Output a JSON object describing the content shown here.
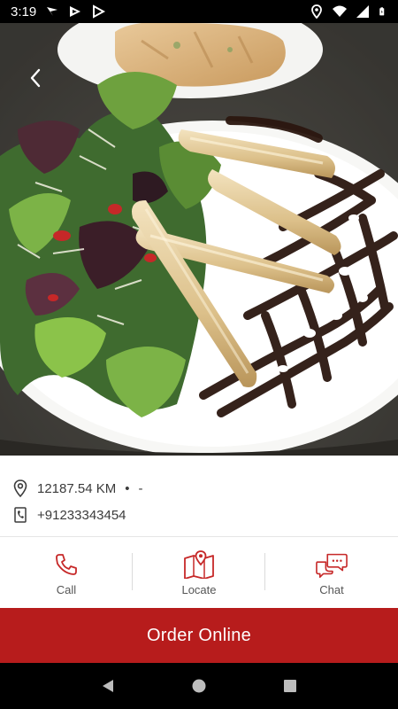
{
  "status_bar": {
    "time": "3:19"
  },
  "header": {
    "back_icon": "chevron-left-icon"
  },
  "info": {
    "distance": "12187.54 KM",
    "separator": "•",
    "extra": "-",
    "phone": "+91233343454",
    "location_icon": "location-pin-icon",
    "phone_icon": "phone-book-icon"
  },
  "actions": {
    "call": {
      "label": "Call",
      "icon": "phone-icon"
    },
    "locate": {
      "label": "Locate",
      "icon": "map-icon"
    },
    "chat": {
      "label": "Chat",
      "icon": "chat-bubbles-icon"
    }
  },
  "order_button": {
    "label": "Order Online",
    "color": "#b71c1c"
  },
  "colors": {
    "accent": "#c62828",
    "status_bar": "#000000"
  }
}
